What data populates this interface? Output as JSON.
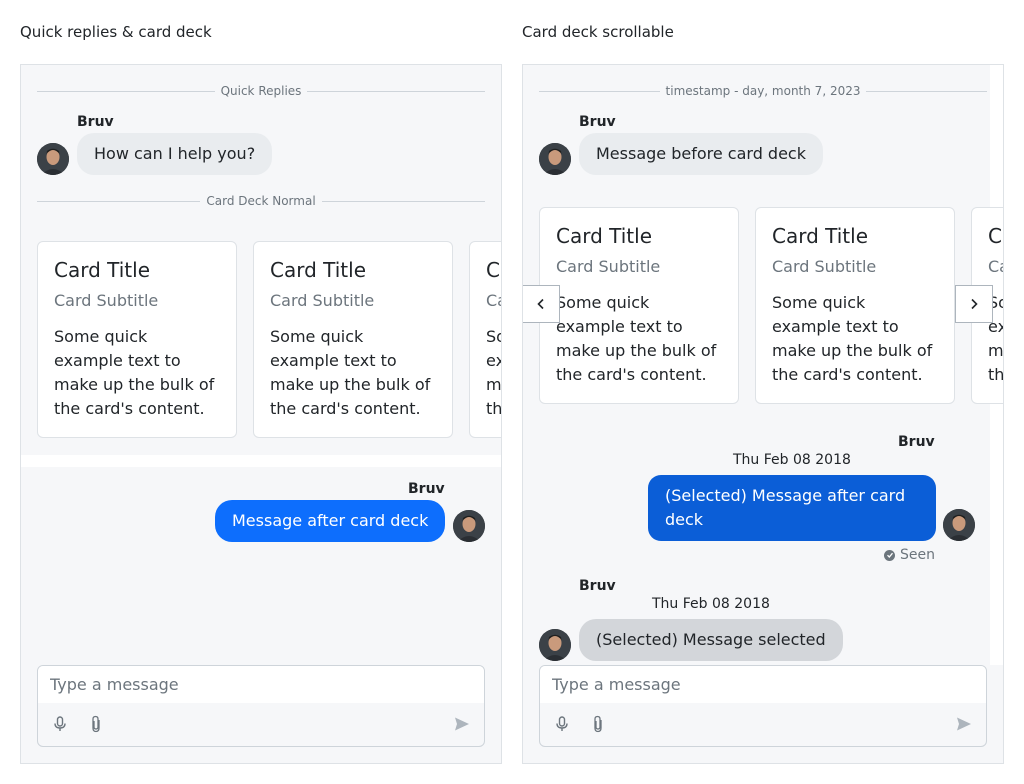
{
  "left": {
    "heading": "Quick replies & card deck",
    "divider_quick": "Quick Replies",
    "msg1": {
      "sender": "Bruv",
      "text": "How can I help you?"
    },
    "divider_deck": "Card Deck Normal",
    "cards": [
      {
        "title": "Card Title",
        "subtitle": "Card Subtitle",
        "text": "Some quick example text to make up the bulk of the card's content."
      },
      {
        "title": "Card Title",
        "subtitle": "Card Subtitle",
        "text": "Some quick example text to make up the bulk of the card's content."
      },
      {
        "title": "Card Title",
        "subtitle": "Card Subtitle",
        "text": "Some quick example text to make up the bulk of the card's content."
      }
    ],
    "msg2": {
      "sender": "Bruv",
      "text": "Message after card deck"
    },
    "composer": {
      "placeholder": "Type a message"
    }
  },
  "right": {
    "heading": "Card deck scrollable",
    "divider": "timestamp - day, month 7, 2023",
    "msg1": {
      "sender": "Bruv",
      "text": "Message before card deck"
    },
    "cards": [
      {
        "title": "Card Title",
        "subtitle": "Card Subtitle",
        "text": "Some quick example text to make up the bulk of the card's content."
      },
      {
        "title": "Card Title",
        "subtitle": "Card Subtitle",
        "text": "Some quick example text to make up the bulk of the card's content."
      },
      {
        "title": "Card Title",
        "subtitle": "Card Subtitle",
        "text": "Some quick example text to make up the bulk of the card's content."
      }
    ],
    "msg2": {
      "sender": "Bruv",
      "timestamp": "Thu Feb 08 2018",
      "text": "(Selected) Message after card deck",
      "status": "Seen"
    },
    "msg3": {
      "sender": "Bruv",
      "timestamp": "Thu Feb 08 2018",
      "text": "(Selected) Message selected"
    },
    "composer": {
      "placeholder": "Type a message"
    }
  },
  "icons": {
    "avatar": "person-avatar",
    "mic": "microphone-icon",
    "attach": "paperclip-icon",
    "send": "send-icon",
    "prev": "chevron-left-icon",
    "next": "chevron-right-icon",
    "seen": "check-circle-icon"
  },
  "colors": {
    "primary": "#0d6efd",
    "primary_selected": "#0b5ed7",
    "bubble_in": "#e9ecef",
    "bubble_in_selected": "#d3d6da",
    "panel_bg": "#f6f7f9",
    "muted": "#6c757d"
  }
}
